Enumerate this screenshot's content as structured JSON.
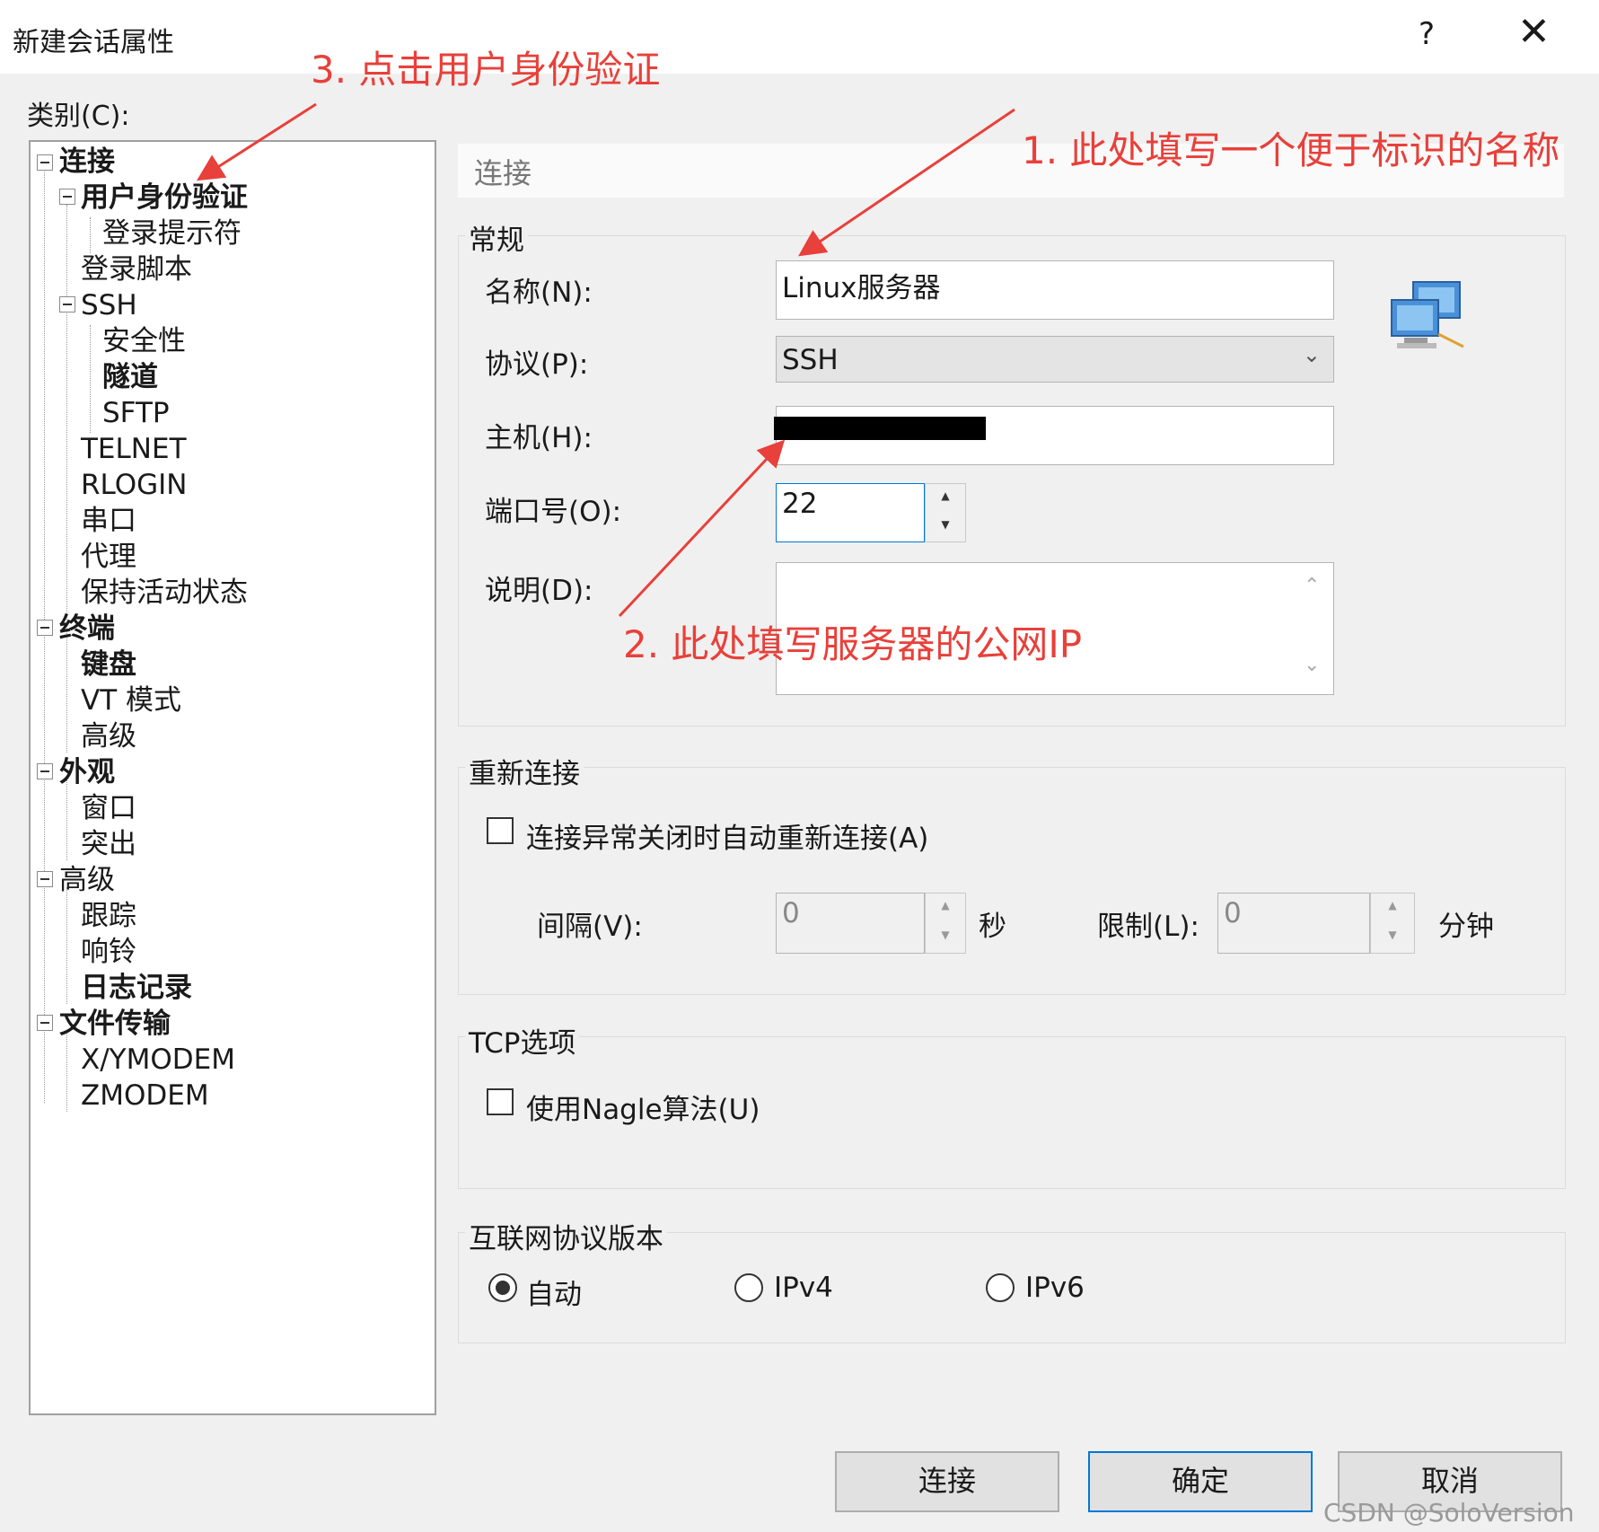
{
  "window": {
    "title": "新建会话属性",
    "help_label": "?",
    "close_label": "✕"
  },
  "category": {
    "label": "类别(C):",
    "items": [
      {
        "label": "连接"
      },
      {
        "label": "用户身份验证"
      },
      {
        "label": "登录提示符"
      },
      {
        "label": "登录脚本"
      },
      {
        "label": "SSH"
      },
      {
        "label": "安全性"
      },
      {
        "label": "隧道"
      },
      {
        "label": "SFTP"
      },
      {
        "label": "TELNET"
      },
      {
        "label": "RLOGIN"
      },
      {
        "label": "串口"
      },
      {
        "label": "代理"
      },
      {
        "label": "保持活动状态"
      },
      {
        "label": "终端"
      },
      {
        "label": "键盘"
      },
      {
        "label": "VT 模式"
      },
      {
        "label": "高级"
      },
      {
        "label": "外观"
      },
      {
        "label": "窗口"
      },
      {
        "label": "突出"
      },
      {
        "label": "高级"
      },
      {
        "label": "跟踪"
      },
      {
        "label": "响铃"
      },
      {
        "label": "日志记录"
      },
      {
        "label": "文件传输"
      },
      {
        "label": "X/YMODEM"
      },
      {
        "label": "ZMODEM"
      }
    ]
  },
  "panel": {
    "header": "连接",
    "general": {
      "title": "常规",
      "name_label": "名称(N):",
      "name_value": "Linux服务器",
      "protocol_label": "协议(P):",
      "protocol_value": "SSH",
      "host_label": "主机(H):",
      "host_value": "",
      "port_label": "端口号(O):",
      "port_value": "22",
      "desc_label": "说明(D):",
      "desc_value": ""
    },
    "reconnect": {
      "title": "重新连接",
      "auto_label": "连接异常关闭时自动重新连接(A)",
      "interval_label": "间隔(V):",
      "interval_value": "0",
      "interval_unit": "秒",
      "limit_label": "限制(L):",
      "limit_value": "0",
      "limit_unit": "分钟"
    },
    "tcp": {
      "title": "TCP选项",
      "nagle_label": "使用Nagle算法(U)"
    },
    "ip": {
      "title": "互联网协议版本",
      "auto": "自动",
      "ipv4": "IPv4",
      "ipv6": "IPv6"
    }
  },
  "buttons": {
    "connect": "连接",
    "ok": "确定",
    "cancel": "取消"
  },
  "annotations": {
    "a1": "1. 此处填写一个便于标识的名称",
    "a2": "2. 此处填写服务器的公网IP",
    "a3": "3. 点击用户身份验证"
  },
  "watermark": "CSDN @SoloVersion",
  "colors": {
    "annotation": "#e8403a",
    "default_button_border": "#0078d7"
  }
}
